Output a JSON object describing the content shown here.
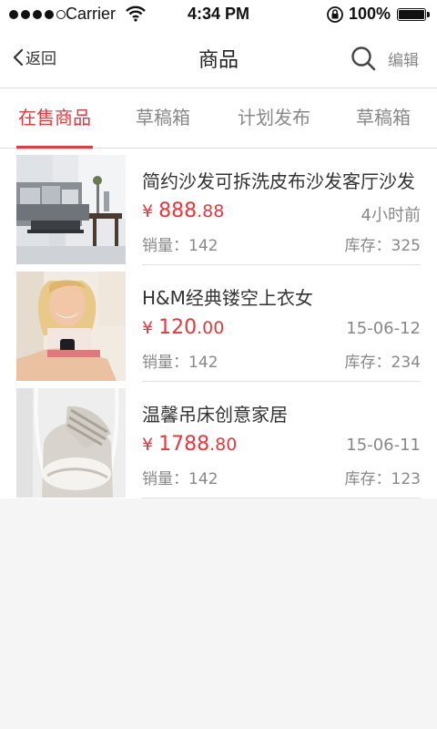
{
  "status_bar": {
    "carrier": "Carrier",
    "time": "4:34 PM",
    "battery": "100%"
  },
  "nav": {
    "back_label": "返回",
    "title": "商品",
    "edit_label": "编辑"
  },
  "tabs": [
    {
      "label": "在售商品",
      "active": true
    },
    {
      "label": "草稿箱",
      "active": false
    },
    {
      "label": "计划发布",
      "active": false
    },
    {
      "label": "草稿箱",
      "active": false
    }
  ],
  "products": [
    {
      "name": "简约沙发可拆洗皮布沙发客厅沙发",
      "currency": "¥",
      "price_int": "888",
      "price_dec": ".88",
      "time": "4小时前",
      "sales_label": "销量：",
      "sales": "142",
      "stock_label": "库存：",
      "stock": "325",
      "image": "sofa-living-room-photo"
    },
    {
      "name": "H&M经典镂空上衣女",
      "currency": "¥",
      "price_int": "120",
      "price_dec": ".00",
      "time": "15-06-12",
      "sales_label": "销量：",
      "sales": "142",
      "stock_label": "库存：",
      "stock": "234",
      "image": "smiling-woman-photo"
    },
    {
      "name": "温馨吊床创意家居",
      "currency": "¥",
      "price_int": "1788",
      "price_dec": ".80",
      "time": "15-06-11",
      "sales_label": "销量：",
      "sales": "142",
      "stock_label": "库存：",
      "stock": "123",
      "image": "hanging-chair-photo"
    }
  ],
  "colors": {
    "accent": "#e8373d",
    "background": "#f5f5f5"
  }
}
